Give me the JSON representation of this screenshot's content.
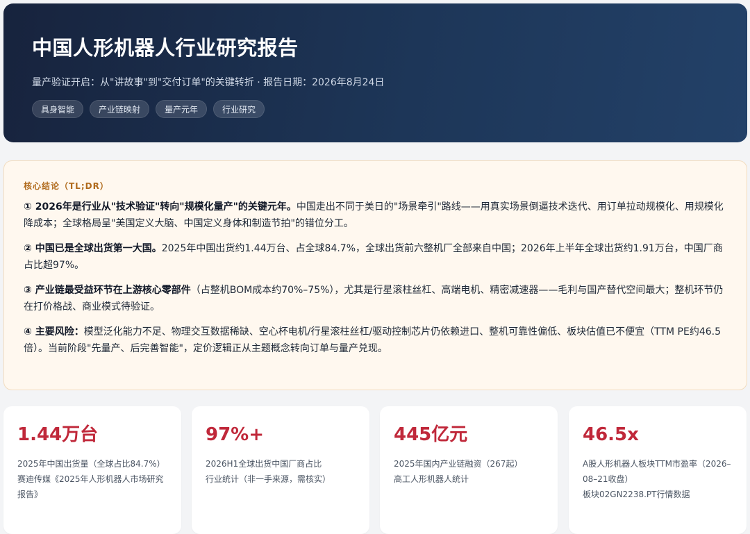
{
  "hero": {
    "title": "中国人形机器人行业研究报告",
    "subtitle": "量产验证开启：从\"讲故事\"到\"交付订单\"的关键转折 · 报告日期：2026年8月24日",
    "tags": [
      "具身智能",
      "产业链映射",
      "量产元年",
      "行业研究"
    ]
  },
  "summary": {
    "label": "核心结论（TL;DR）",
    "points": [
      {
        "lead": "① 2026年是行业从\"技术验证\"转向\"规模化量产\"的关键元年。",
        "text": "中国走出不同于美日的\"场景牵引\"路线——用真实场景倒逼技术迭代、用订单拉动规模化、用规模化降成本；全球格局呈\"美国定义大脑、中国定义身体和制造节拍\"的错位分工。"
      },
      {
        "lead": "② 中国已是全球出货第一大国。",
        "text": "2025年中国出货约1.44万台、占全球84.7%，全球出货前六整机厂全部来自中国；2026年上半年全球出货约1.91万台，中国厂商占比超97%。"
      },
      {
        "lead": "③ 产业链最受益环节在上游核心零部件",
        "text": "（占整机BOM成本约70%–75%），尤其是行星滚柱丝杠、高端电机、精密减速器——毛利与国产替代空间最大；整机环节仍在打价格战、商业模式待验证。"
      },
      {
        "lead": "④ 主要风险：",
        "text": "模型泛化能力不足、物理交互数据稀缺、空心杯电机/行星滚柱丝杠/驱动控制芯片仍依赖进口、整机可靠性偏低、板块估值已不便宜（TTM PE约46.5倍）。当前阶段\"先量产、后完善智能\"，定价逻辑正从主题概念转向订单与量产兑现。"
      }
    ]
  },
  "cards": [
    {
      "value": "1.44万台",
      "desc": "2025年中国出货量（全球占比84.7%）",
      "source": "赛迪传媒《2025年人形机器人市场研究报告》"
    },
    {
      "value": "97%+",
      "desc": "2026H1全球出货中国厂商占比",
      "source": "行业统计（非一手来源，需核实）"
    },
    {
      "value": "445亿元",
      "desc": "2025年国内产业链融资（267起）",
      "source": "高工人形机器人统计"
    },
    {
      "value": "46.5x",
      "desc": "A股人形机器人板块TTM市盈率（2026–08–21收盘）",
      "source": "板块02GN2238.PT行情数据"
    }
  ],
  "colors": {
    "hero_bg": "#1d3658",
    "accent_value": "#c0283a",
    "summary_label": "#b06a1c",
    "summary_bg": "#fff8ef"
  }
}
